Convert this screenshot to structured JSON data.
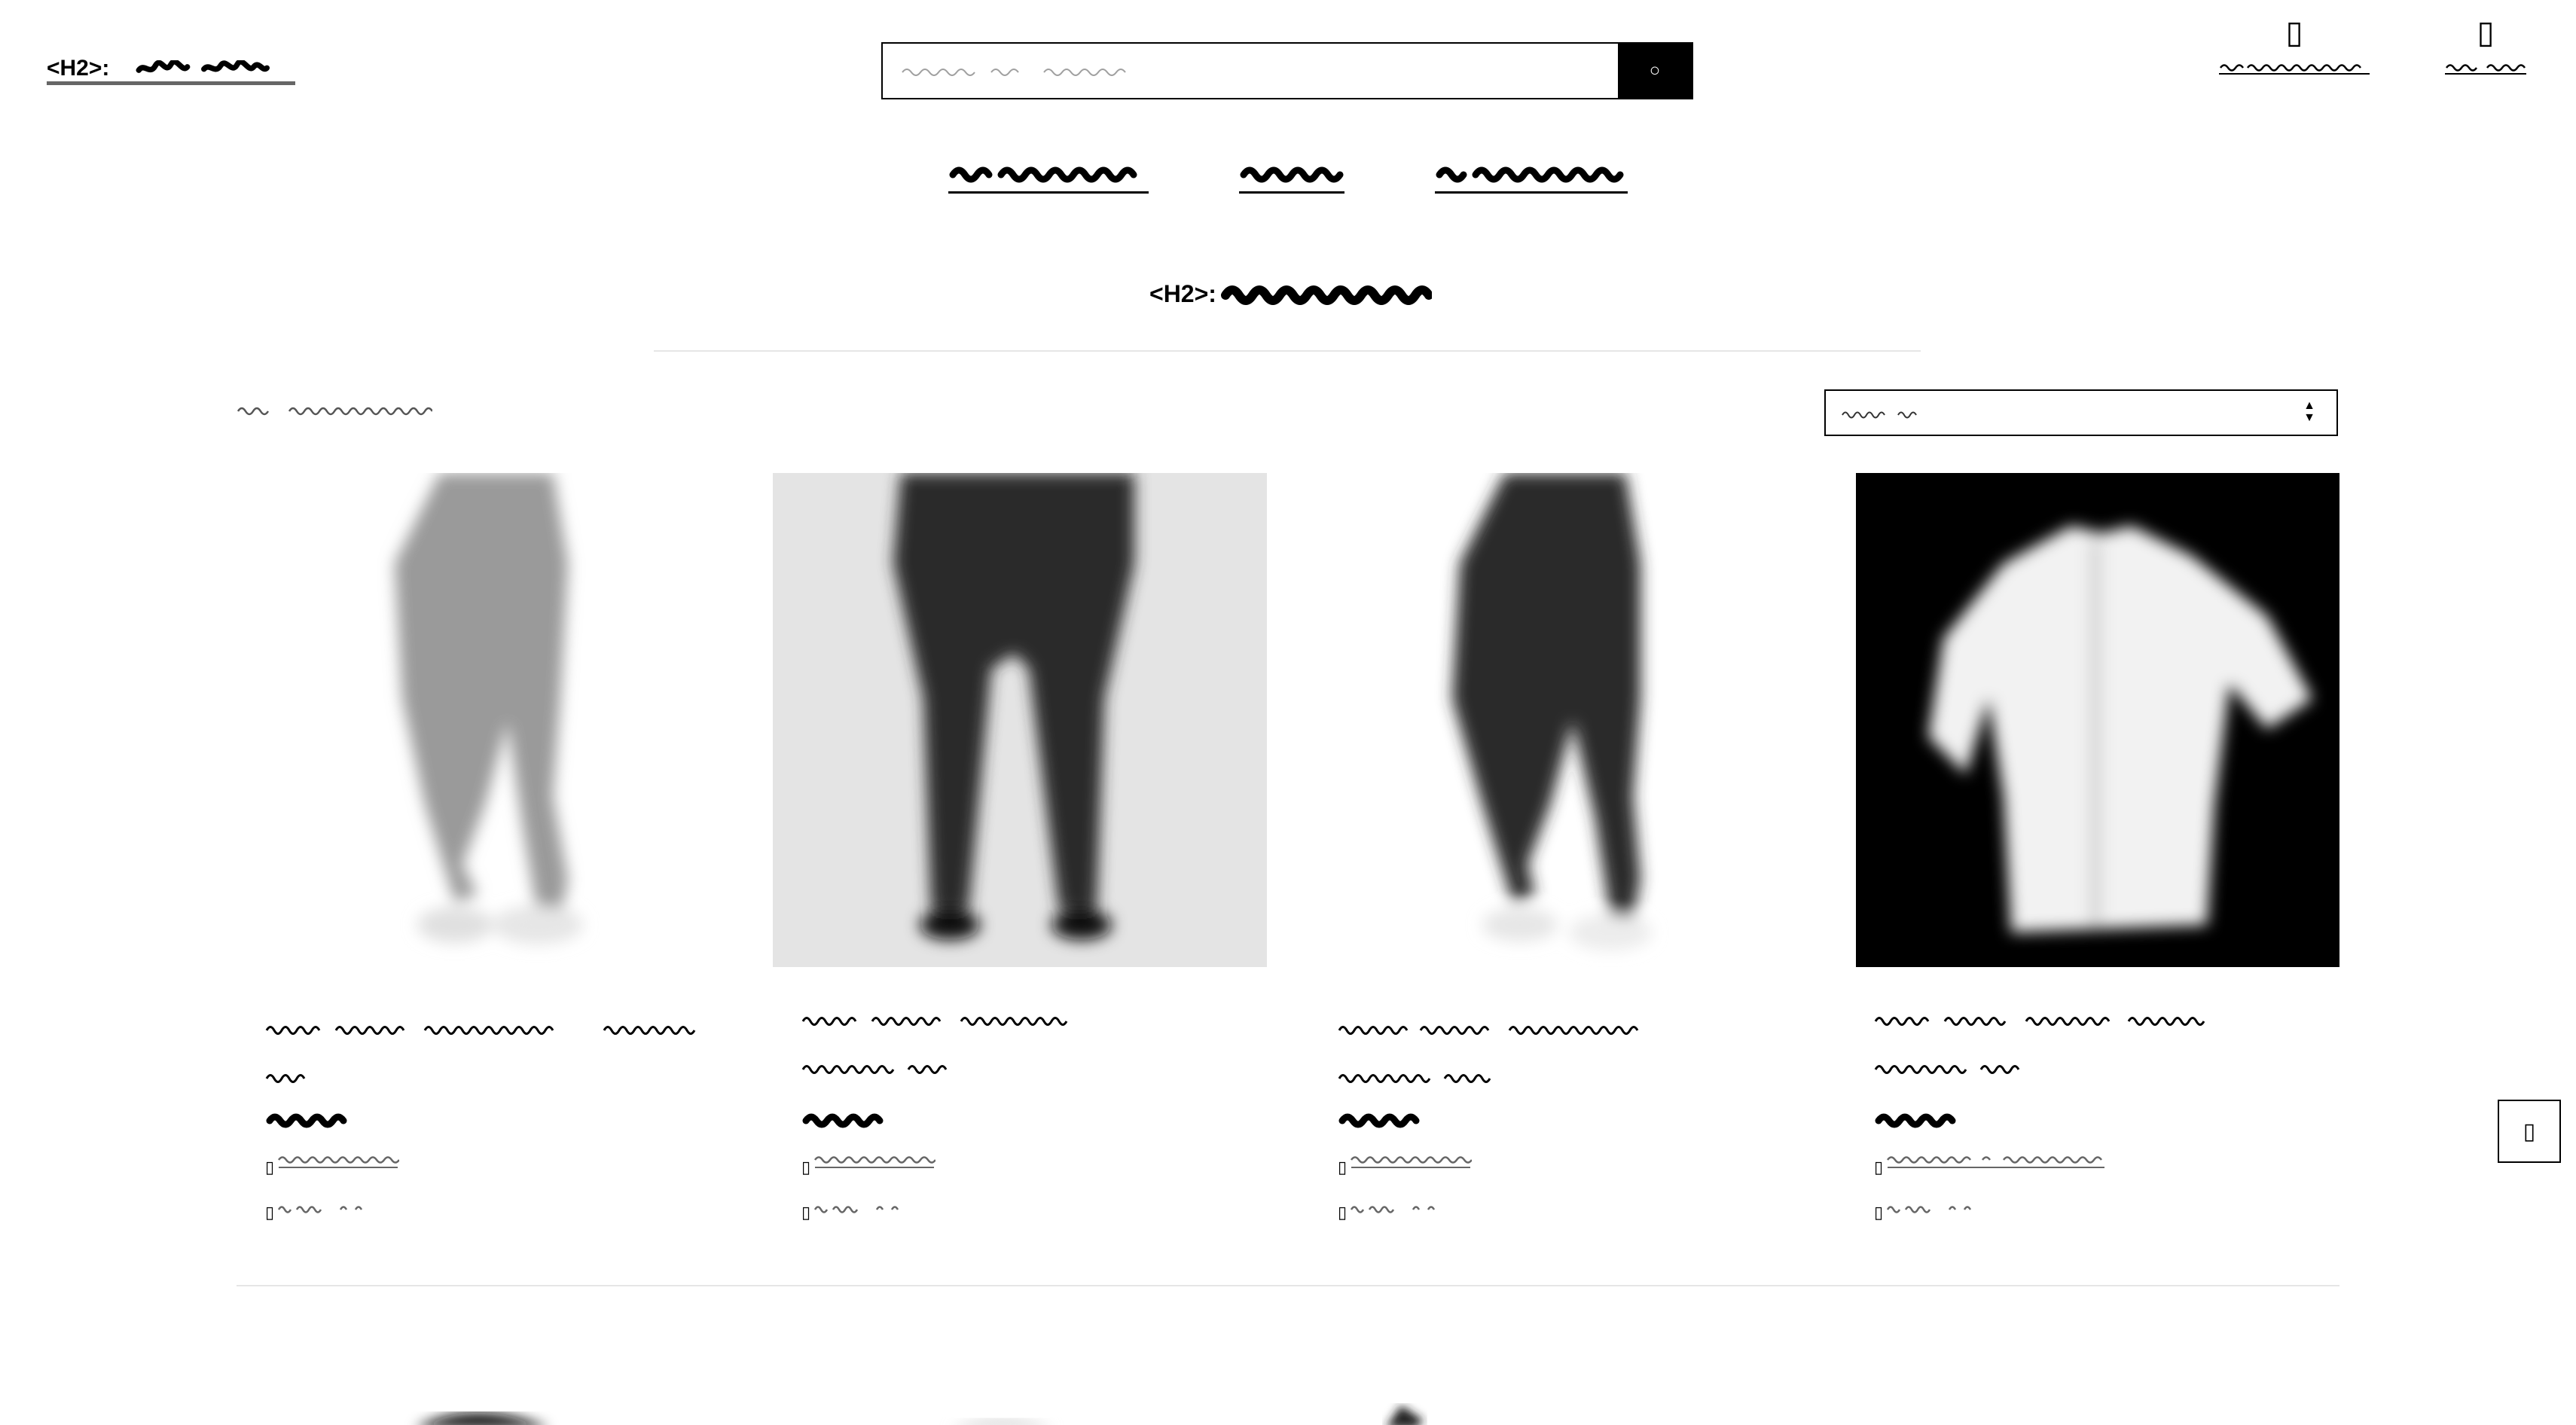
{
  "header": {
    "logo_tag": "<H2>:",
    "search": {
      "placeholder": ""
    },
    "actions": [
      {
        "label": "",
        "icon": "user-icon"
      },
      {
        "label": "",
        "icon": "cart-icon"
      }
    ]
  },
  "nav": {
    "items": [
      "",
      "",
      ""
    ]
  },
  "page": {
    "title_tag": "<H2>:",
    "count_text": "",
    "sort_value": ""
  },
  "products": [
    {
      "name": "",
      "price": "",
      "info_label": "",
      "rating": ""
    },
    {
      "name": "",
      "price": "",
      "info_label": "",
      "rating": ""
    },
    {
      "name": "",
      "price": "",
      "info_label": "",
      "rating": ""
    },
    {
      "name": "",
      "price": "",
      "info_label": "",
      "rating": ""
    }
  ],
  "colors": {
    "text": "#000000",
    "muted": "#666666",
    "rule": "#e6e6e6",
    "accent": "#000000"
  }
}
